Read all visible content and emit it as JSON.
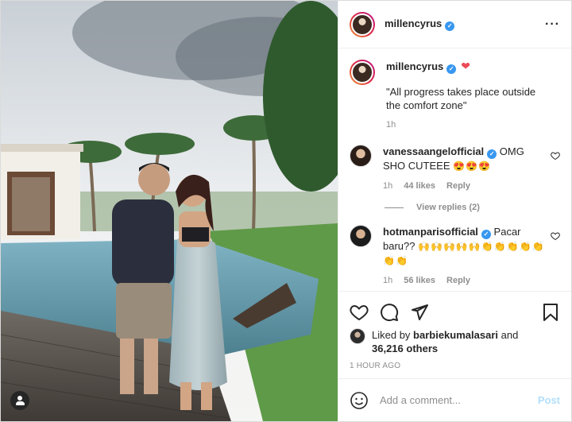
{
  "post": {
    "username": "millencyrus",
    "caption": "\"All progress takes place outside the comfort zone\"",
    "caption_time": "1h"
  },
  "comments": [
    {
      "username": "vanessaangelofficial",
      "text": "OMG SHO CUTEEE",
      "emoji": "😍😍😍",
      "time": "1h",
      "likes": "44 likes",
      "reply": "Reply",
      "view_replies": "View replies (2)"
    },
    {
      "username": "hotmanparisofficial",
      "text": "Pacar baru??",
      "emoji": "🙌🙌🙌🙌🙌👏👏👏👏👏👏👏",
      "time": "1h",
      "likes": "56 likes",
      "reply": "Reply"
    }
  ],
  "likes": {
    "prefix": "Liked by",
    "user": "barbiekumalasari",
    "and": "and",
    "count": "36,216 others"
  },
  "timestamp": "1 HOUR AGO",
  "comment_box": {
    "placeholder": "Add a comment...",
    "post_label": "Post"
  },
  "icons": {
    "more": "more-options-icon",
    "like": "heart-icon",
    "comment": "comment-icon",
    "share": "paper-plane-icon",
    "save": "bookmark-icon",
    "emoji": "smiley-icon",
    "tags": "user-tag-icon"
  }
}
